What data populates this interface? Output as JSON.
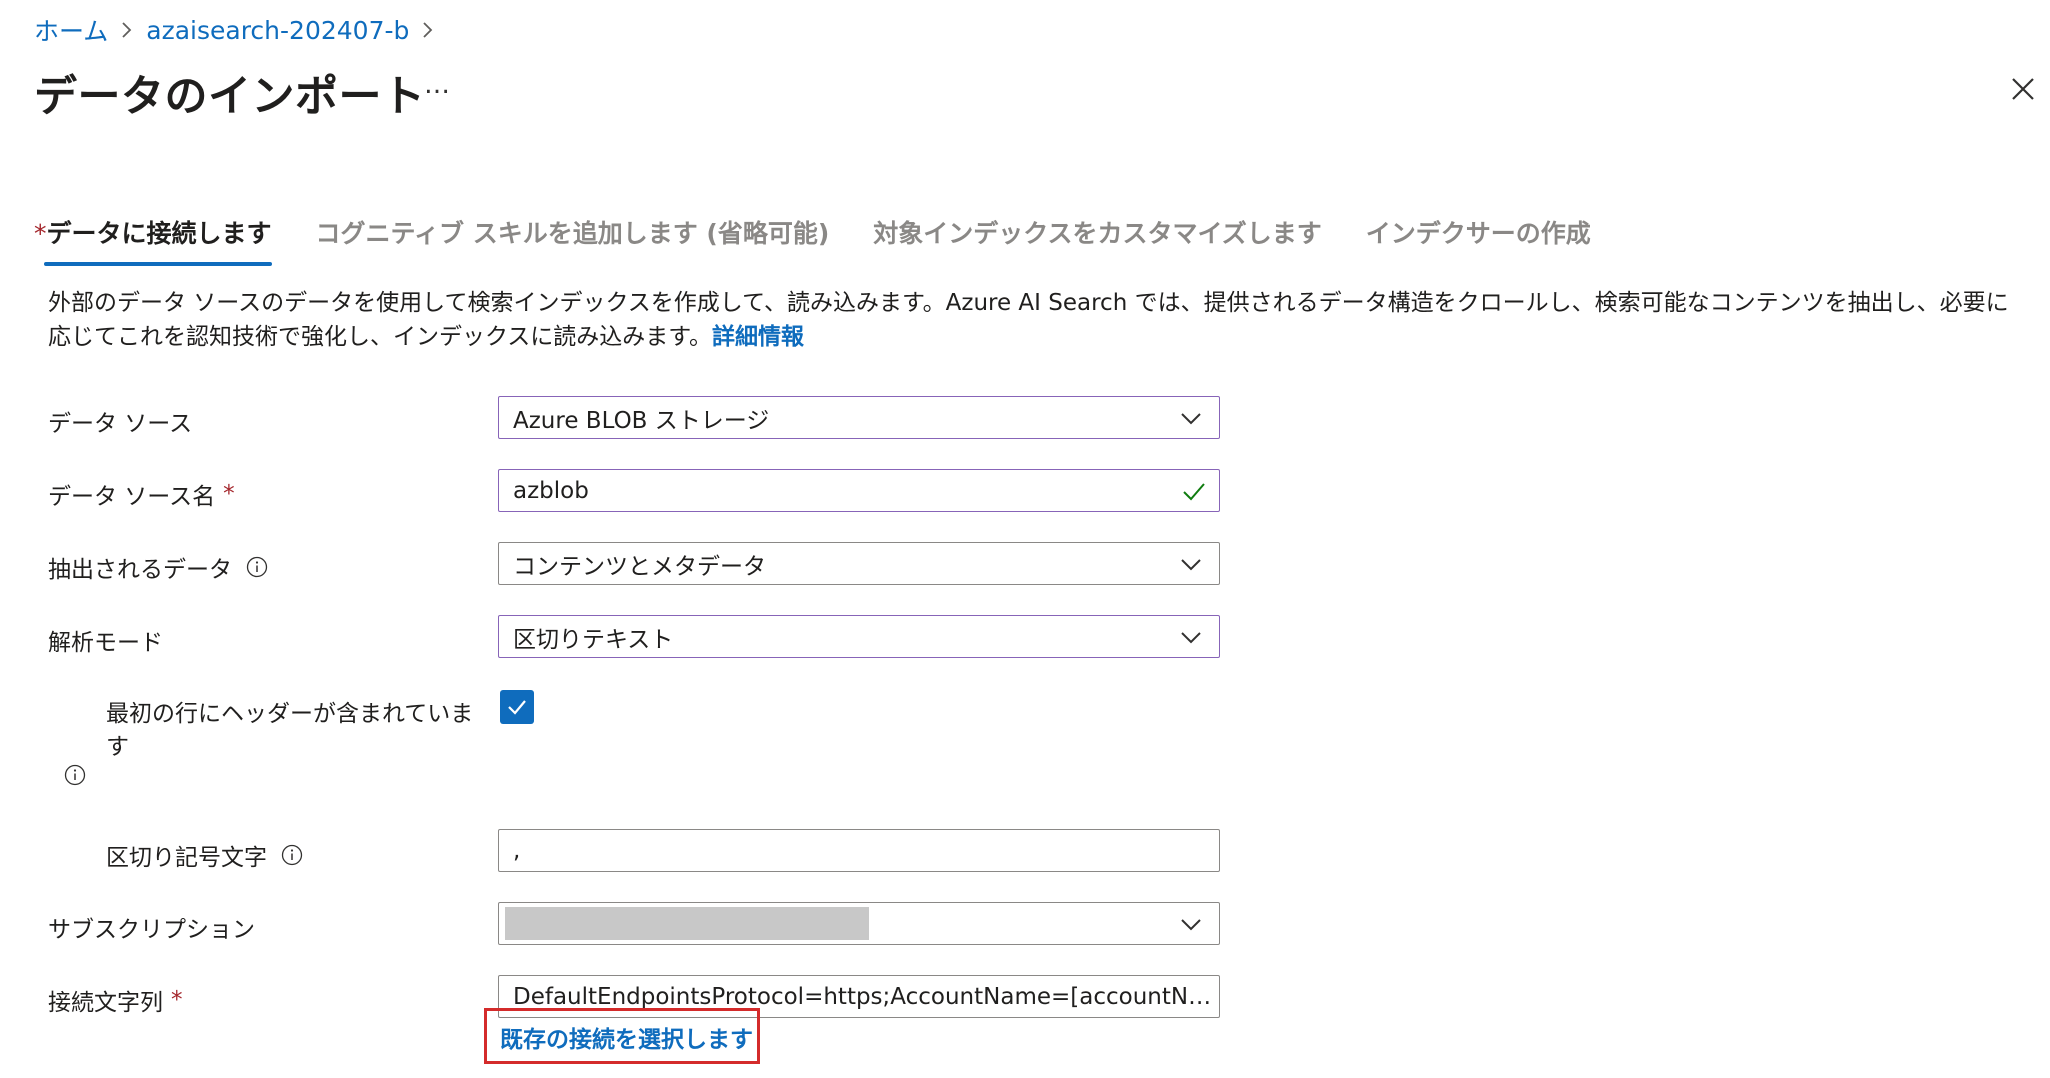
{
  "breadcrumb": {
    "home": "ホーム",
    "resource": "azaisearch-202407-b"
  },
  "title": "データのインポート",
  "more_label": "…",
  "tabs": [
    {
      "label": "データに接続します",
      "required_mark": "*",
      "active": true
    },
    {
      "label": "コグニティブ スキルを追加します (省略可能)"
    },
    {
      "label": "対象インデックスをカスタマイズします"
    },
    {
      "label": "インデクサーの作成"
    }
  ],
  "description": {
    "text": "外部のデータ ソースのデータを使用して検索インデックスを作成して、読み込みます。Azure AI Search では、提供されるデータ構造をクロールし、検索可能なコンテンツを抽出し、必要に応じてこれを認知技術で強化し、インデックスに読み込みます。",
    "link": "詳細情報"
  },
  "form": {
    "data_source": {
      "label": "データ ソース",
      "value": "Azure BLOB ストレージ"
    },
    "data_source_name": {
      "label": "データ ソース名",
      "required": "*",
      "value": "azblob"
    },
    "extracted_data": {
      "label": "抽出されるデータ",
      "value": "コンテンツとメタデータ"
    },
    "parsing_mode": {
      "label": "解析モード",
      "value": "区切りテキスト"
    },
    "first_line_header": {
      "label_line1": "最初の行にヘッダーが含まれていま",
      "label_line2": "す",
      "checked": true
    },
    "delimiter": {
      "label": "区切り記号文字",
      "value": ","
    },
    "subscription": {
      "label": "サブスクリプション",
      "value": ""
    },
    "connection_string": {
      "label": "接続文字列",
      "required": "*",
      "value": "DefaultEndpointsProtocol=https;AccountName=[accountName];AccountKey=[accountKey]"
    },
    "choose_existing": "既存の接続を選択します"
  },
  "colors": {
    "accent": "#0f6cbd",
    "required": "#a4262c",
    "highlight_box": "#d42b2b",
    "focus_border": "#8764b8",
    "valid_check": "#107c10"
  }
}
